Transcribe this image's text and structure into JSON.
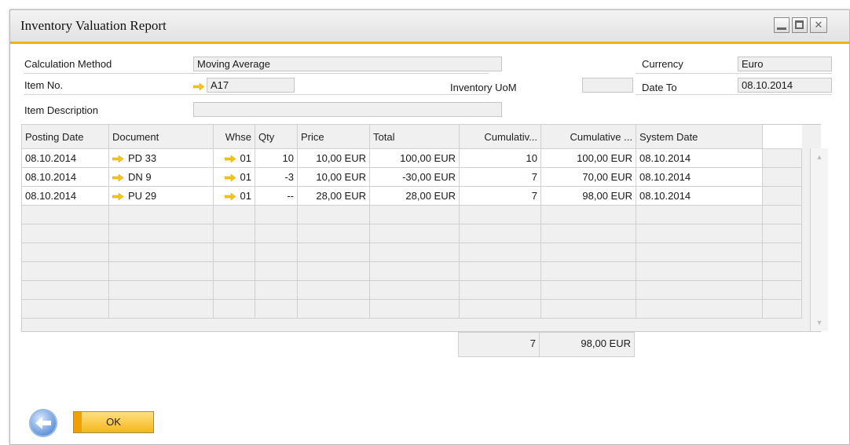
{
  "window": {
    "title": "Inventory Valuation Report"
  },
  "header": {
    "calc_method_label": "Calculation Method",
    "calc_method_value": "Moving Average",
    "currency_label": "Currency",
    "currency_value": "Euro",
    "item_no_label": "Item No.",
    "item_no_value": "A17",
    "inventory_uom_label": "Inventory UoM",
    "inventory_uom_value": "",
    "date_to_label": "Date To",
    "date_to_value": "08.10.2014",
    "item_desc_label": "Item Description",
    "item_desc_value": ""
  },
  "table": {
    "columns": [
      "Posting Date",
      "Document",
      "Whse",
      "Qty",
      "Price",
      "Total",
      "Cumulativ...",
      "Cumulative ...",
      "System Date"
    ],
    "rows": [
      {
        "posting_date": "08.10.2014",
        "document": "PD 33",
        "whse": "01",
        "qty": "10",
        "price": "10,00 EUR",
        "total": "100,00 EUR",
        "cum_qty": "10",
        "cum_total": "100,00 EUR",
        "system_date": "08.10.2014"
      },
      {
        "posting_date": "08.10.2014",
        "document": "DN 9",
        "whse": "01",
        "qty": "-3",
        "price": "10,00 EUR",
        "total": "-30,00 EUR",
        "cum_qty": "7",
        "cum_total": "70,00 EUR",
        "system_date": "08.10.2014"
      },
      {
        "posting_date": "08.10.2014",
        "document": "PU 29",
        "whse": "01",
        "qty": "--",
        "price": "28,00 EUR",
        "total": "28,00 EUR",
        "cum_qty": "7",
        "cum_total": "98,00 EUR",
        "system_date": "08.10.2014"
      }
    ],
    "totals": {
      "cum_qty": "7",
      "cum_total": "98,00 EUR"
    }
  },
  "footer": {
    "ok_label": "OK"
  },
  "colors": {
    "accent": "#f1b00e",
    "link_arrow": "#f5c518",
    "button": "#f5b61a"
  },
  "icons": [
    "link-arrow-icon",
    "back-icon",
    "minimize-icon",
    "maximize-icon",
    "close-icon",
    "scroll-up-icon",
    "scroll-down-icon"
  ]
}
